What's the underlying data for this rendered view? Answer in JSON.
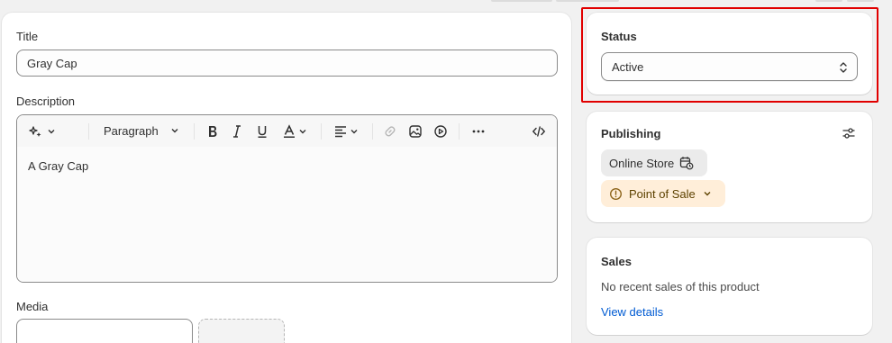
{
  "form": {
    "title_label": "Title",
    "title_value": "Gray Cap",
    "description_label": "Description",
    "description_value": "A Gray Cap",
    "media_label": "Media",
    "toolbar": {
      "paragraph_label": "Paragraph"
    }
  },
  "status": {
    "title": "Status",
    "selected": "Active"
  },
  "publishing": {
    "title": "Publishing",
    "channels": [
      {
        "label": "Online Store"
      },
      {
        "label": "Point of Sale"
      }
    ]
  },
  "sales": {
    "title": "Sales",
    "message": "No recent sales of this product",
    "link": "View details"
  },
  "colors": {
    "highlight": "#e10000",
    "link": "#005bd3",
    "warning_bg": "#ffeed9"
  }
}
